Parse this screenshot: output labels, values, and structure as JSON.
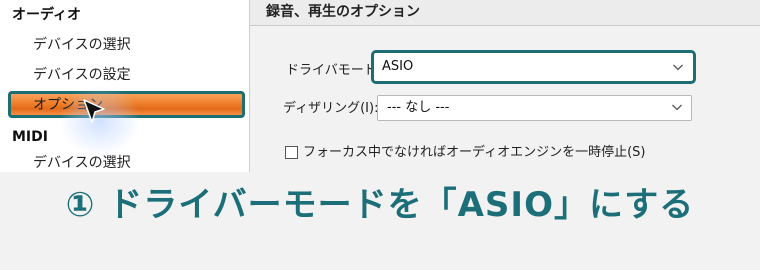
{
  "sidebar": {
    "audio_heading": "オーディオ",
    "items": [
      {
        "label": "デバイスの選択"
      },
      {
        "label": "デバイスの設定"
      },
      {
        "label": "オプション"
      }
    ],
    "midi_heading": "MIDI",
    "midi_items": [
      {
        "label": "デバイスの選択"
      }
    ]
  },
  "main": {
    "title": "録音、再生のオプション",
    "driver_mode": {
      "label": "ドライバモード(D)",
      "value": "ASIO"
    },
    "dithering": {
      "label": "ディザリング(I):",
      "value": "--- なし ---"
    },
    "pause_checkbox": {
      "label": "フォーカス中でなければオーディオエンジンを一時停止(S)",
      "checked": false
    }
  },
  "caption": {
    "text": "① ドライバーモードを「ASIO」にする"
  },
  "colors": {
    "highlight": "#1d6d72",
    "selection": "#ef7f2a",
    "caption": "#1c6f78"
  },
  "icons": {
    "cursor": "arrow-cursor-icon",
    "chevron": "chevron-down-icon"
  }
}
